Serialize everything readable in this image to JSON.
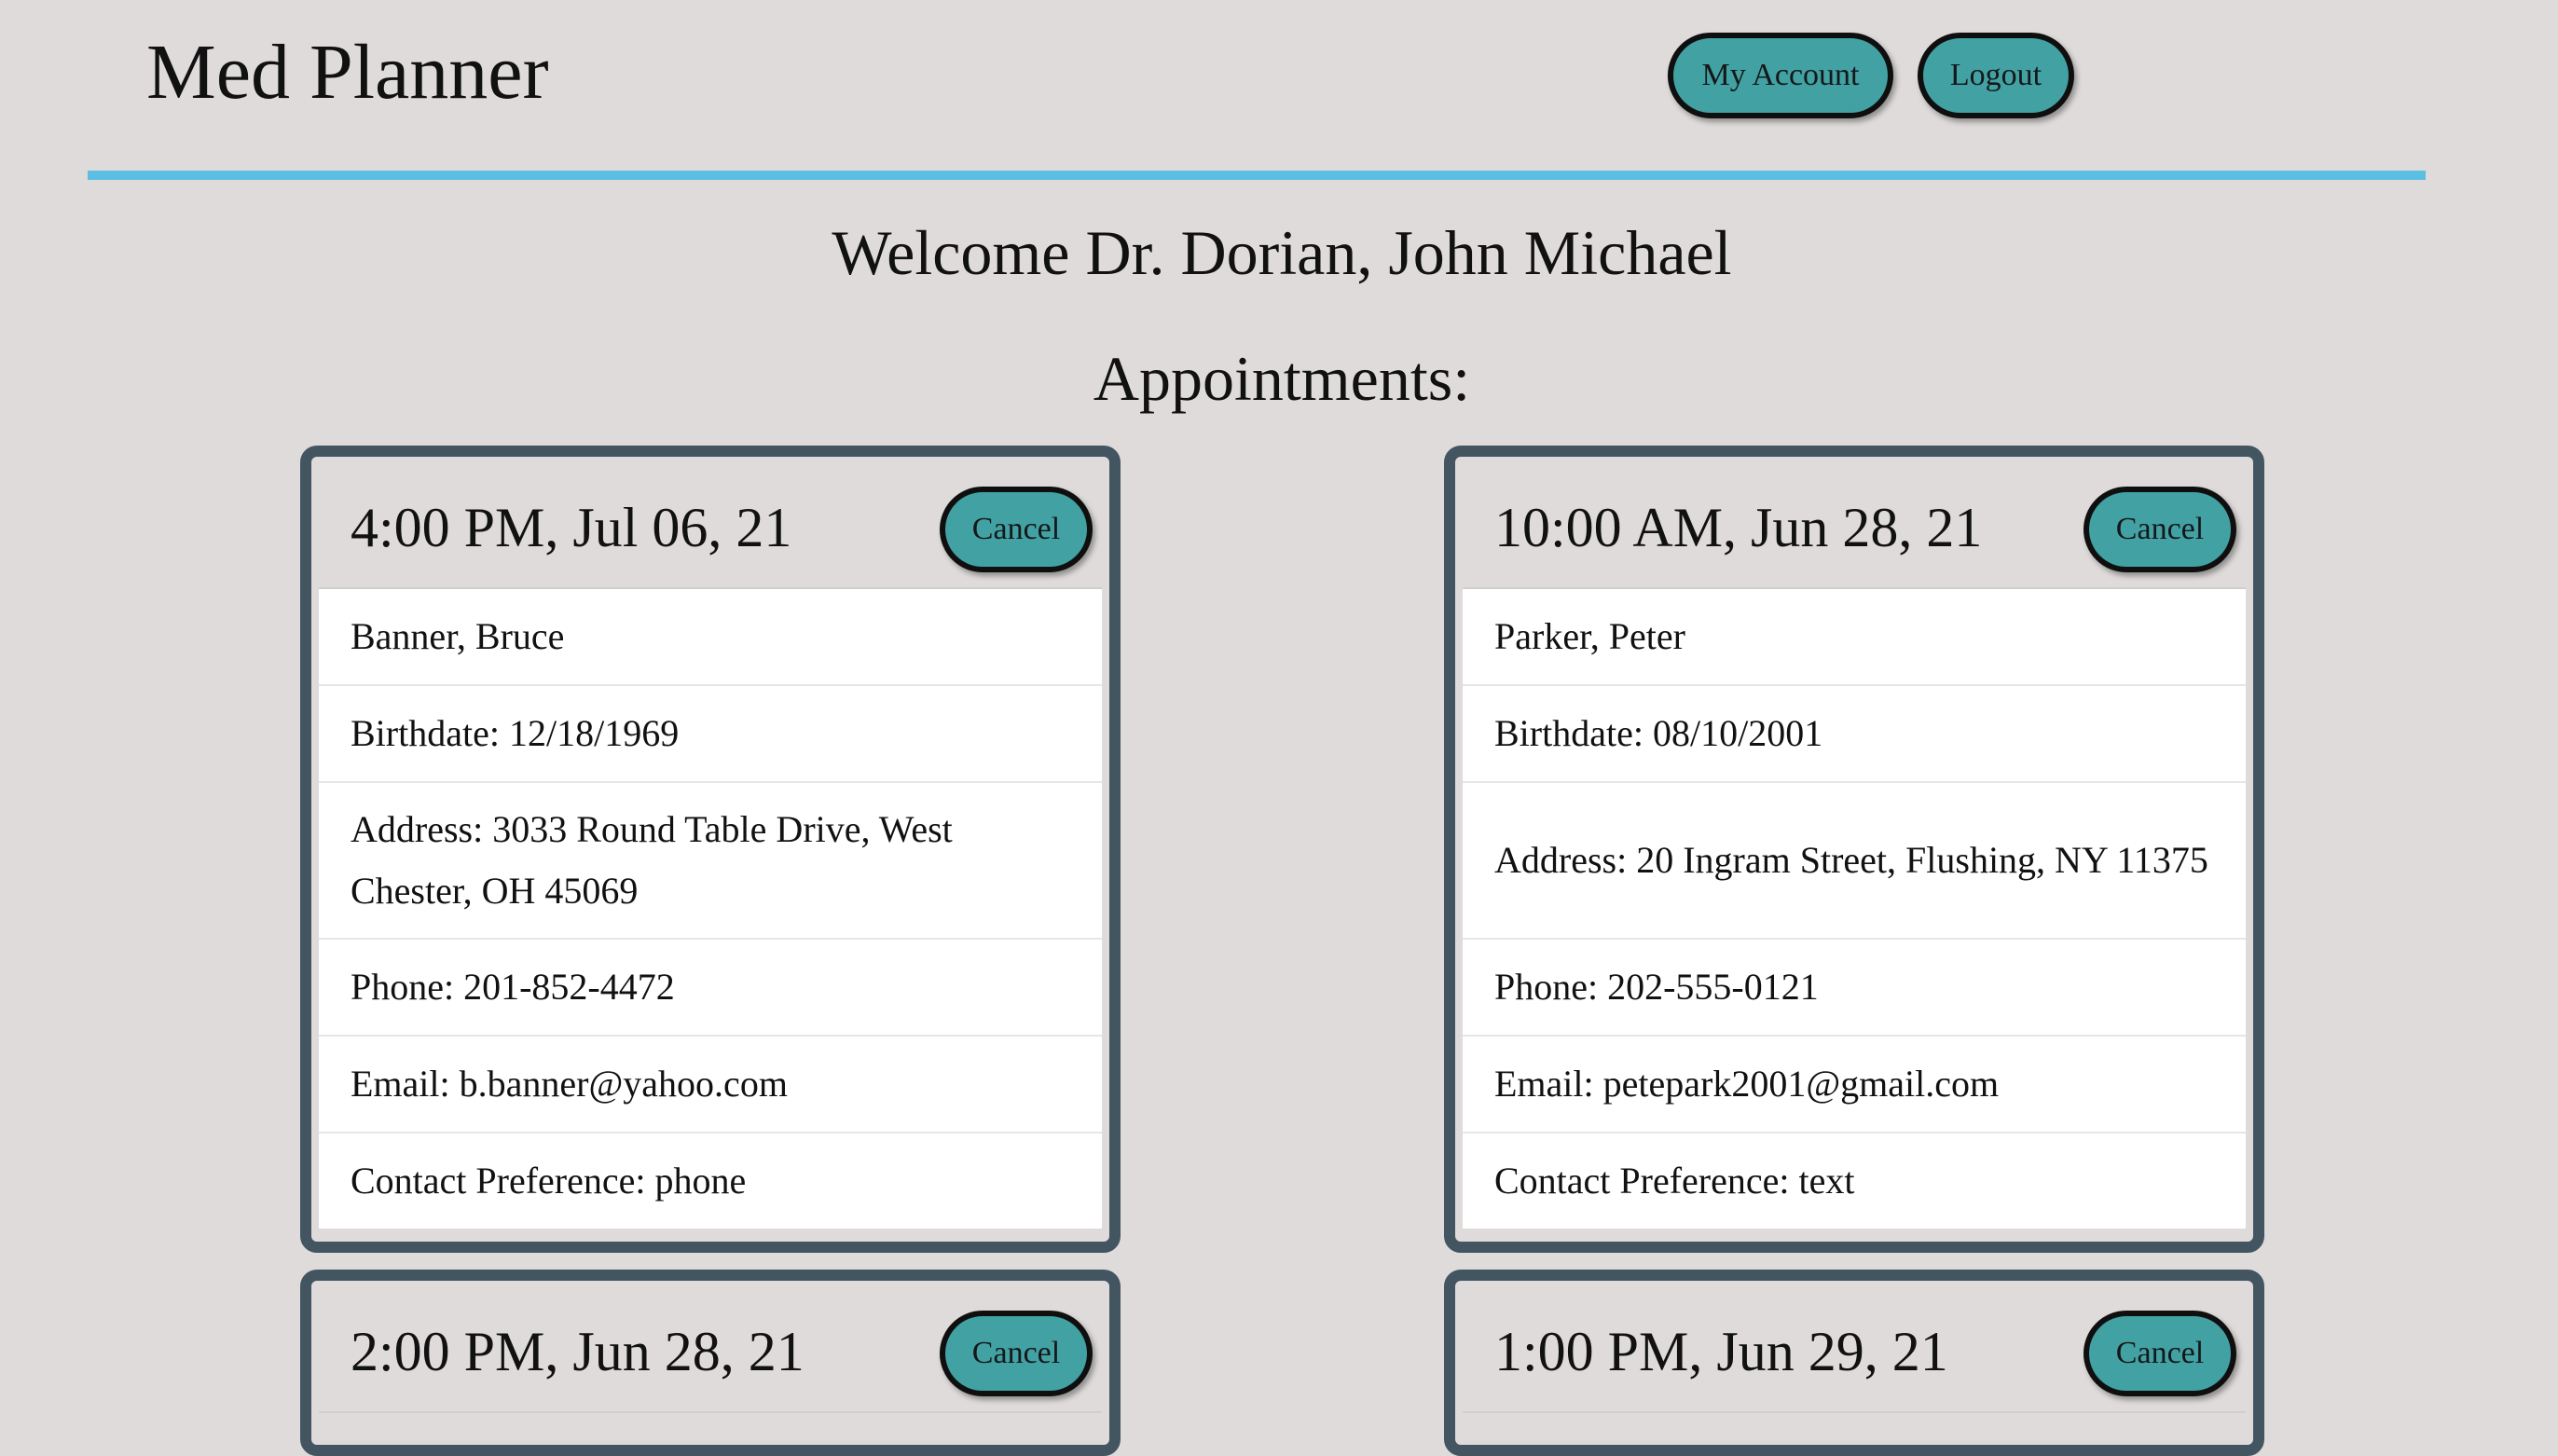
{
  "header": {
    "app_title": "Med Planner",
    "my_account_label": "My Account",
    "logout_label": "Logout",
    "divider_color": "#5bbfe4"
  },
  "welcome": "Welcome Dr. Dorian, John Michael",
  "appointments_heading": "Appointments:",
  "appointments": [
    {
      "time": "4:00 PM, Jul 06, 21",
      "cancel_label": "Cancel",
      "name": "Banner, Bruce",
      "birthdate": "Birthdate: 12/18/1969",
      "address": "Address: 3033 Round Table Drive, West Chester, OH 45069",
      "phone": "Phone: 201-852-4472",
      "email": "Email: b.banner@yahoo.com",
      "contact_preference": "Contact Preference: phone"
    },
    {
      "time": "10:00 AM, Jun 28, 21",
      "cancel_label": "Cancel",
      "name": "Parker, Peter",
      "birthdate": "Birthdate: 08/10/2001",
      "address": "Address: 20 Ingram Street, Flushing, NY 11375",
      "phone": "Phone: 202-555-0121",
      "email": "Email: petepark2001@gmail.com",
      "contact_preference": "Contact Preference: text"
    },
    {
      "time": "2:00 PM, Jun 28, 21",
      "cancel_label": "Cancel"
    },
    {
      "time": "1:00 PM, Jun 29, 21",
      "cancel_label": "Cancel"
    }
  ],
  "colors": {
    "background": "#dfdbdb",
    "button_fill": "#42a1a3",
    "card_border": "#435561",
    "accent_line": "#5bbfe4"
  }
}
